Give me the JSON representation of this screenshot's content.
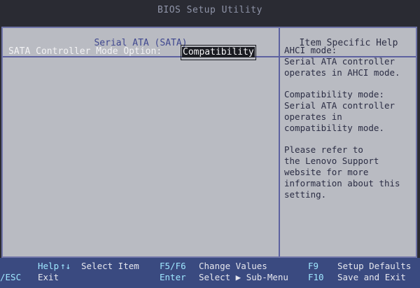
{
  "window": {
    "title": "BIOS Setup Utility"
  },
  "main": {
    "section_title": "Serial ATA (SATA)",
    "setting": {
      "label": "SATA Controller Mode Option:",
      "value": "Compatibility"
    }
  },
  "help": {
    "title": "Item Specific Help",
    "paragraphs": [
      "AHCI mode:\nSerial ATA controller\noperates in AHCI mode.",
      "Compatibility mode:\nSerial ATA controller\noperates in\ncompatibility mode.",
      "Please refer to\nthe Lenovo Support\nwebsite for more\ninformation about this\nsetting."
    ]
  },
  "footer": {
    "row1": [
      {
        "key": "Help",
        "symbol": "↑↓",
        "desc": "Select Item"
      },
      {
        "key": "F5/F6",
        "desc": "Change Values"
      },
      {
        "key": "F9",
        "desc": "Setup Defaults"
      }
    ],
    "row2": [
      {
        "key": "/ESC",
        "desc": "Exit"
      },
      {
        "key": "Enter",
        "desc": "Select ▶ Sub-Menu"
      },
      {
        "key": "F10",
        "desc": "Save and Exit"
      }
    ]
  },
  "colors": {
    "background": "#b9bbc2",
    "footer": "#3a4a80",
    "border": "#6f74a8",
    "section_title": "#3f478f"
  }
}
